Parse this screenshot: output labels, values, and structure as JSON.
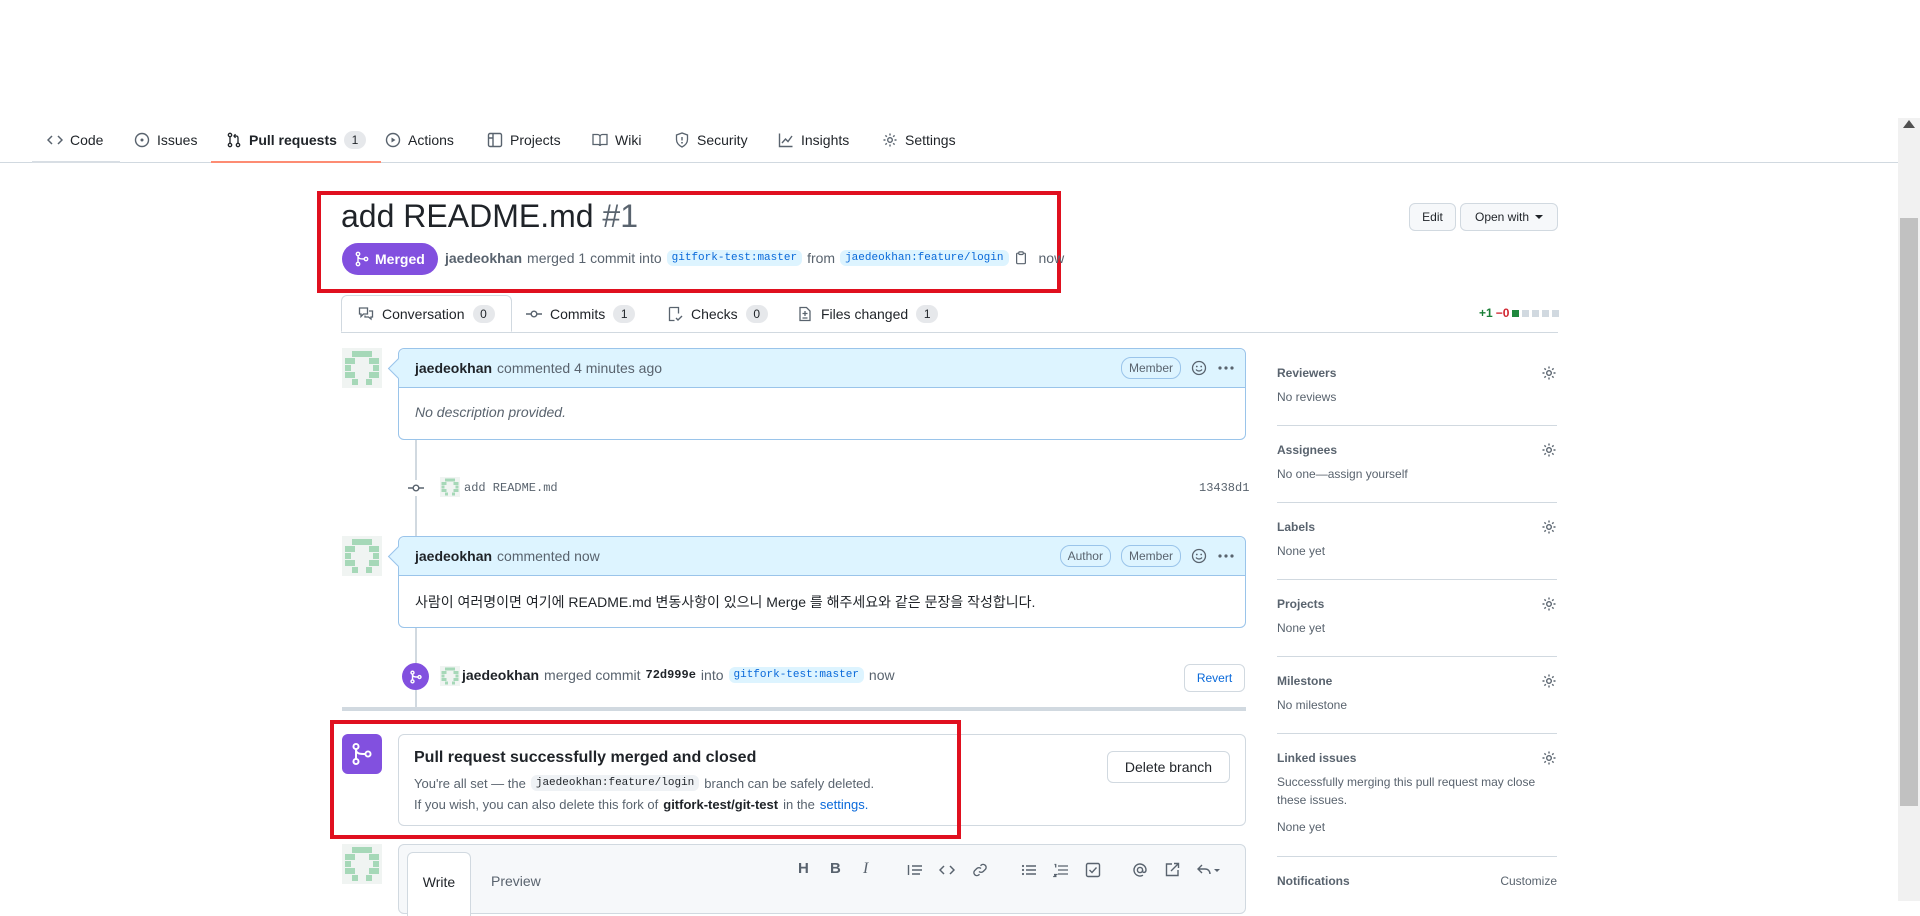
{
  "repo_nav": {
    "tabs": [
      {
        "label": "Code",
        "icon": "code-icon"
      },
      {
        "label": "Issues",
        "icon": "issue-opened-icon"
      },
      {
        "label": "Pull requests",
        "icon": "git-pull-request-icon",
        "count": "1",
        "active": true
      },
      {
        "label": "Actions",
        "icon": "play-icon"
      },
      {
        "label": "Projects",
        "icon": "table-icon"
      },
      {
        "label": "Wiki",
        "icon": "book-icon"
      },
      {
        "label": "Security",
        "icon": "shield-icon"
      },
      {
        "label": "Insights",
        "icon": "graph-icon"
      },
      {
        "label": "Settings",
        "icon": "gear-icon"
      }
    ]
  },
  "pr": {
    "title": "add README.md",
    "number": "#1",
    "state": "Merged",
    "author": "jaedeokhan",
    "merged_text": "merged 1 commit into",
    "base_branch": "gitfork-test:master",
    "from_text": "from",
    "head_branch": "jaedeokhan:feature/login",
    "time": "now",
    "edit_label": "Edit",
    "open_with_label": "Open with"
  },
  "pr_tabs": [
    {
      "label": "Conversation",
      "count": "0",
      "icon": "comment-discussion-icon"
    },
    {
      "label": "Commits",
      "count": "1",
      "icon": "git-commit-icon"
    },
    {
      "label": "Checks",
      "count": "0",
      "icon": "checklist-icon"
    },
    {
      "label": "Files changed",
      "count": "1",
      "icon": "file-diff-icon"
    }
  ],
  "diffstat": {
    "additions": "+1",
    "deletions": "−0"
  },
  "timeline": {
    "comment1": {
      "author": "jaedeokhan",
      "action": "commented 4 minutes ago",
      "labels": [
        "Member"
      ],
      "body": "No description provided."
    },
    "commit": {
      "message": "add README.md",
      "sha": "13438d1"
    },
    "comment2": {
      "author": "jaedeokhan",
      "action": "commented now",
      "labels": [
        "Author",
        "Member"
      ],
      "body": "사람이 여러명이면 여기에 README.md 변동사항이 있으니 Merge 를 해주세요와 같은 문장을 작성합니다."
    },
    "merge_event": {
      "author": "jaedeokhan",
      "text": "merged commit",
      "sha": "72d999e",
      "into": "into",
      "branch": "gitfork-test:master",
      "time": "now",
      "revert_label": "Revert"
    }
  },
  "merge_box": {
    "title": "Pull request successfully merged and closed",
    "line1_prefix": "You're all set — the",
    "line1_branch": "jaedeokhan:feature/login",
    "line1_suffix": "branch can be safely deleted.",
    "line2_prefix": "If you wish, you can also delete this fork of",
    "line2_repo": "gitfork-test/git-test",
    "line2_mid": "in the",
    "line2_link": "settings.",
    "delete_label": "Delete branch"
  },
  "write_box": {
    "write_tab": "Write",
    "preview_tab": "Preview"
  },
  "sidebar": {
    "reviewers": {
      "title": "Reviewers",
      "value": "No reviews"
    },
    "assignees": {
      "title": "Assignees",
      "value": "No one—assign yourself"
    },
    "labels": {
      "title": "Labels",
      "value": "None yet"
    },
    "projects": {
      "title": "Projects",
      "value": "None yet"
    },
    "milestone": {
      "title": "Milestone",
      "value": "No milestone"
    },
    "linked_issues": {
      "title": "Linked issues",
      "value": "Successfully merging this pull request may close these issues.",
      "value2": "None yet"
    },
    "notifications": {
      "title": "Notifications",
      "action": "Customize"
    }
  },
  "colors": {
    "merged": "#8250df",
    "highlight": "#e0101f",
    "link": "#0969da",
    "active_tab_underline": "#fd8c73"
  }
}
